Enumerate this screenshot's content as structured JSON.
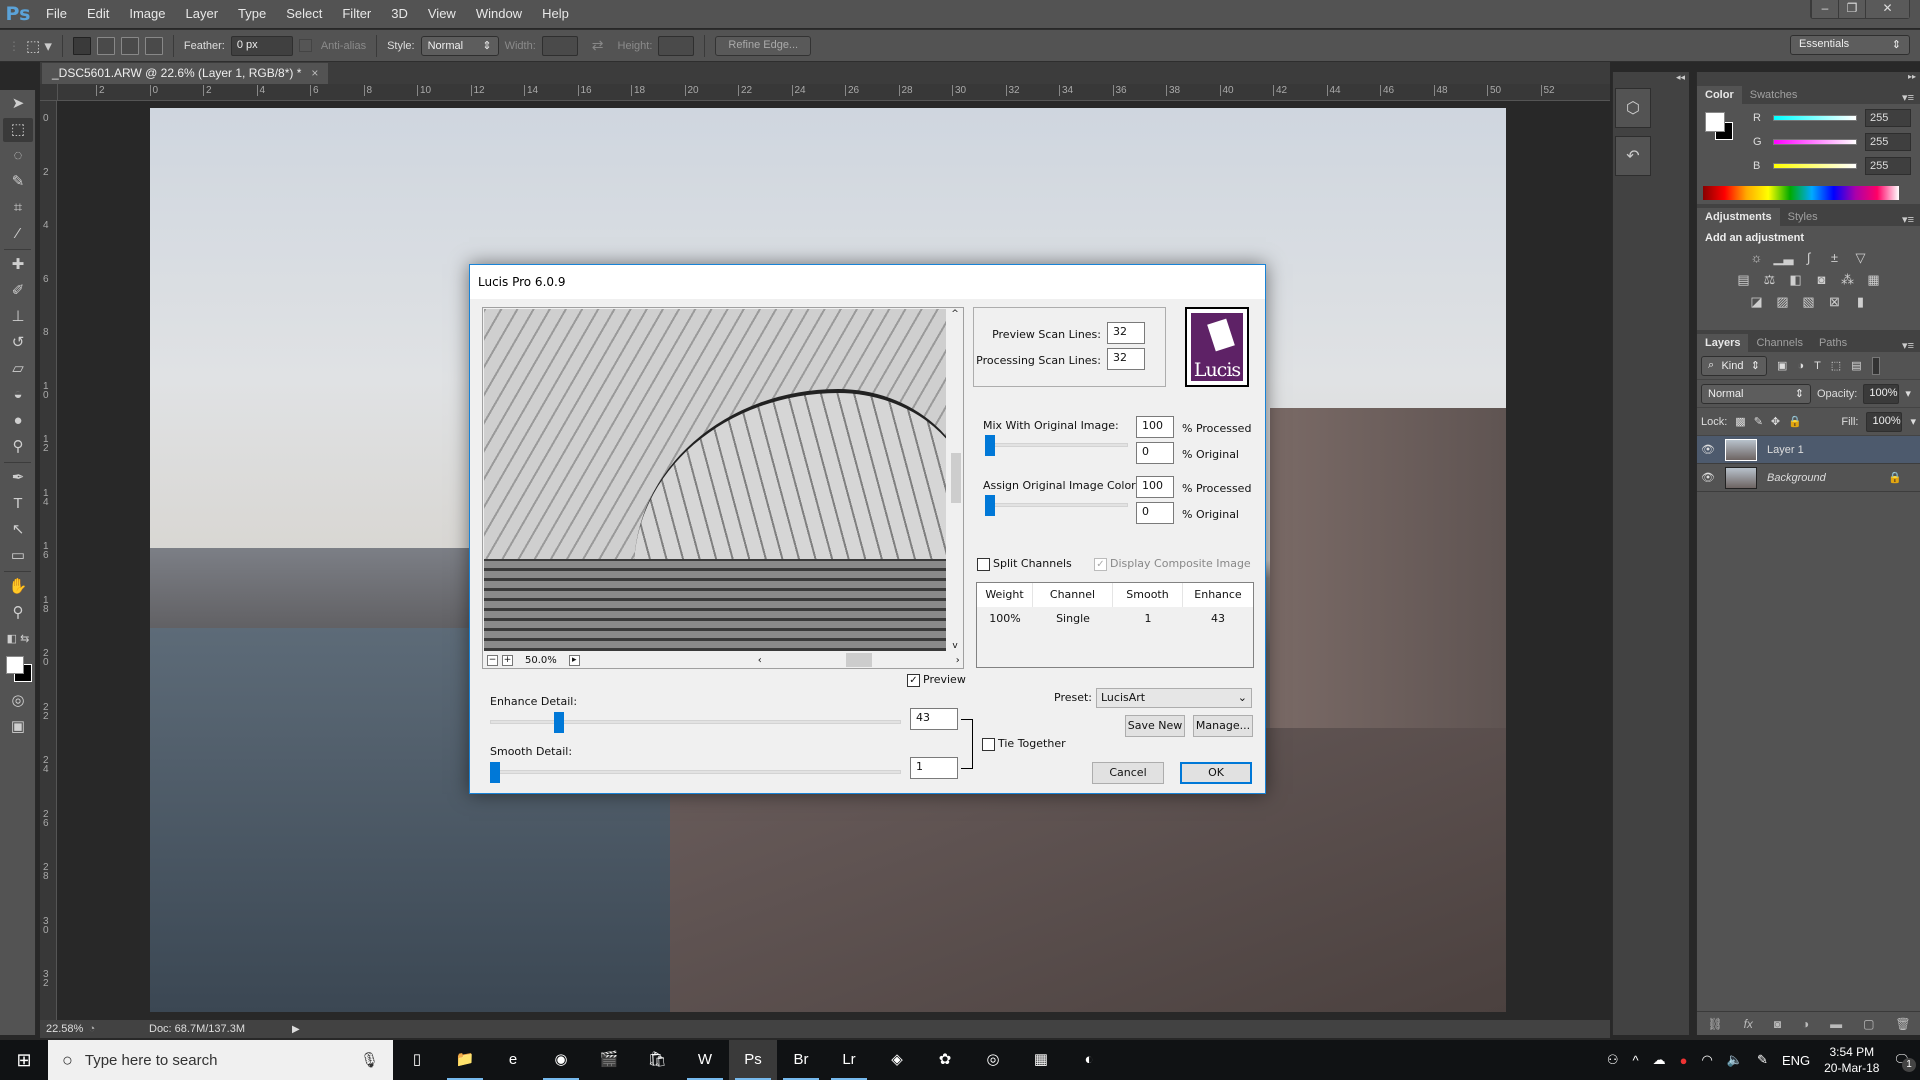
{
  "app": {
    "logo": "Ps",
    "menu": [
      "File",
      "Edit",
      "Image",
      "Layer",
      "Type",
      "Select",
      "Filter",
      "3D",
      "View",
      "Window",
      "Help"
    ],
    "window_controls": {
      "minimize": "–",
      "restore": "❐",
      "close": "✕"
    }
  },
  "options_bar": {
    "feather_label": "Feather:",
    "feather_value": "0 px",
    "antialias_label": "Anti-alias",
    "style_label": "Style:",
    "style_value": "Normal",
    "width_label": "Width:",
    "height_label": "Height:",
    "refine_edge": "Refine Edge...",
    "workspace": "Essentials"
  },
  "document": {
    "tab_title": "_DSC5601.ARW @ 22.6% (Layer 1, RGB/8*) *",
    "close": "×",
    "hruler_labels": [
      "2",
      "0",
      "2",
      "4",
      "6",
      "8",
      "10",
      "12",
      "14",
      "16",
      "18",
      "20",
      "22",
      "24",
      "26",
      "28",
      "30",
      "32",
      "34",
      "36",
      "38",
      "40",
      "42",
      "44",
      "46",
      "48",
      "50",
      "52"
    ],
    "vruler_labels": [
      "0",
      "2",
      "4",
      "6",
      "8",
      "10",
      "12",
      "14",
      "16",
      "18",
      "20",
      "22",
      "24",
      "26",
      "28",
      "30",
      "32"
    ]
  },
  "status": {
    "zoom": "22.58%",
    "doc": "Doc: 68.7M/137.3M"
  },
  "color_panel": {
    "tabs": [
      "Color",
      "Swatches"
    ],
    "channels": [
      {
        "name": "R",
        "value": "255",
        "color": "#00ffff"
      },
      {
        "name": "G",
        "value": "255",
        "color": "#ff00ff"
      },
      {
        "name": "B",
        "value": "255",
        "color": "#ffff00"
      }
    ]
  },
  "adjustments_panel": {
    "tabs": [
      "Adjustments",
      "Styles"
    ],
    "heading": "Add an adjustment",
    "rows": [
      [
        "brightness-contrast",
        "levels",
        "curves",
        "exposure",
        "vibrance"
      ],
      [
        "hue-saturation",
        "color-balance",
        "black-white",
        "photo-filter",
        "channel-mixer",
        "color-lookup"
      ],
      [
        "invert",
        "posterize",
        "threshold",
        "selective-color",
        "gradient-map"
      ]
    ]
  },
  "layers_panel": {
    "tabs": [
      "Layers",
      "Channels",
      "Paths"
    ],
    "filter_kind": "Kind",
    "blend_mode": "Normal",
    "opacity_label": "Opacity:",
    "opacity": "100%",
    "lock_label": "Lock:",
    "fill_label": "Fill:",
    "fill": "100%",
    "layers": [
      {
        "name": "Layer 1",
        "selected": true,
        "locked": false
      },
      {
        "name": "Background",
        "selected": false,
        "locked": true
      }
    ]
  },
  "dialog": {
    "title": "Lucis Pro 6.0.9",
    "preview_zoom": "50.0%",
    "preview_label": "Preview",
    "preview_checked": true,
    "preview_scan_lines_label": "Preview Scan Lines:",
    "preview_scan_lines": "32",
    "processing_scan_lines_label": "Processing Scan Lines:",
    "processing_scan_lines": "32",
    "logo_text": "Lucis",
    "mix_label": "Mix With Original Image:",
    "mix_processed": "100",
    "mix_original": "0",
    "mix_slider_fraction": 0.0,
    "assign_label": "Assign Original Image Color:",
    "assign_processed": "100",
    "assign_original": "0",
    "assign_slider_fraction": 0.0,
    "pct_processed": "% Processed",
    "pct_original": "% Original",
    "split_channels": "Split Channels",
    "display_composite": "Display Composite Image",
    "table": {
      "columns": [
        "Weight",
        "Channel",
        "Smooth",
        "Enhance"
      ],
      "rows": [
        [
          "100%",
          "Single",
          "1",
          "43"
        ]
      ]
    },
    "enhance_label": "Enhance Detail:",
    "enhance_value": "43",
    "enhance_fraction": 0.16,
    "smooth_label": "Smooth Detail:",
    "smooth_value": "1",
    "smooth_fraction": 0.0,
    "tie_together": "Tie Together",
    "preset_label": "Preset:",
    "preset_value": "LucisArt",
    "save_new": "Save New",
    "manage": "Manage...",
    "cancel": "Cancel",
    "ok": "OK"
  },
  "taskbar": {
    "search_placeholder": "Type here to search",
    "apps": [
      {
        "name": "task-view",
        "glyph": "▯"
      },
      {
        "name": "file-explorer",
        "glyph": "📁"
      },
      {
        "name": "edge",
        "glyph": "e"
      },
      {
        "name": "chrome",
        "glyph": "◉"
      },
      {
        "name": "movies",
        "glyph": "🎬"
      },
      {
        "name": "store",
        "glyph": "🛍"
      },
      {
        "name": "word",
        "glyph": "W"
      },
      {
        "name": "photoshop",
        "glyph": "Ps"
      },
      {
        "name": "bridge",
        "glyph": "Br"
      },
      {
        "name": "lightroom",
        "glyph": "Lr"
      },
      {
        "name": "premiere-clip",
        "glyph": "◈"
      },
      {
        "name": "davinci-resolve",
        "glyph": "✿"
      },
      {
        "name": "groove",
        "glyph": "◎"
      },
      {
        "name": "calculator",
        "glyph": "▦"
      },
      {
        "name": "photos-app",
        "glyph": "◐"
      }
    ],
    "language": "ENG",
    "time": "3:54 PM",
    "date": "20-Mar-18",
    "notifications": "1"
  }
}
